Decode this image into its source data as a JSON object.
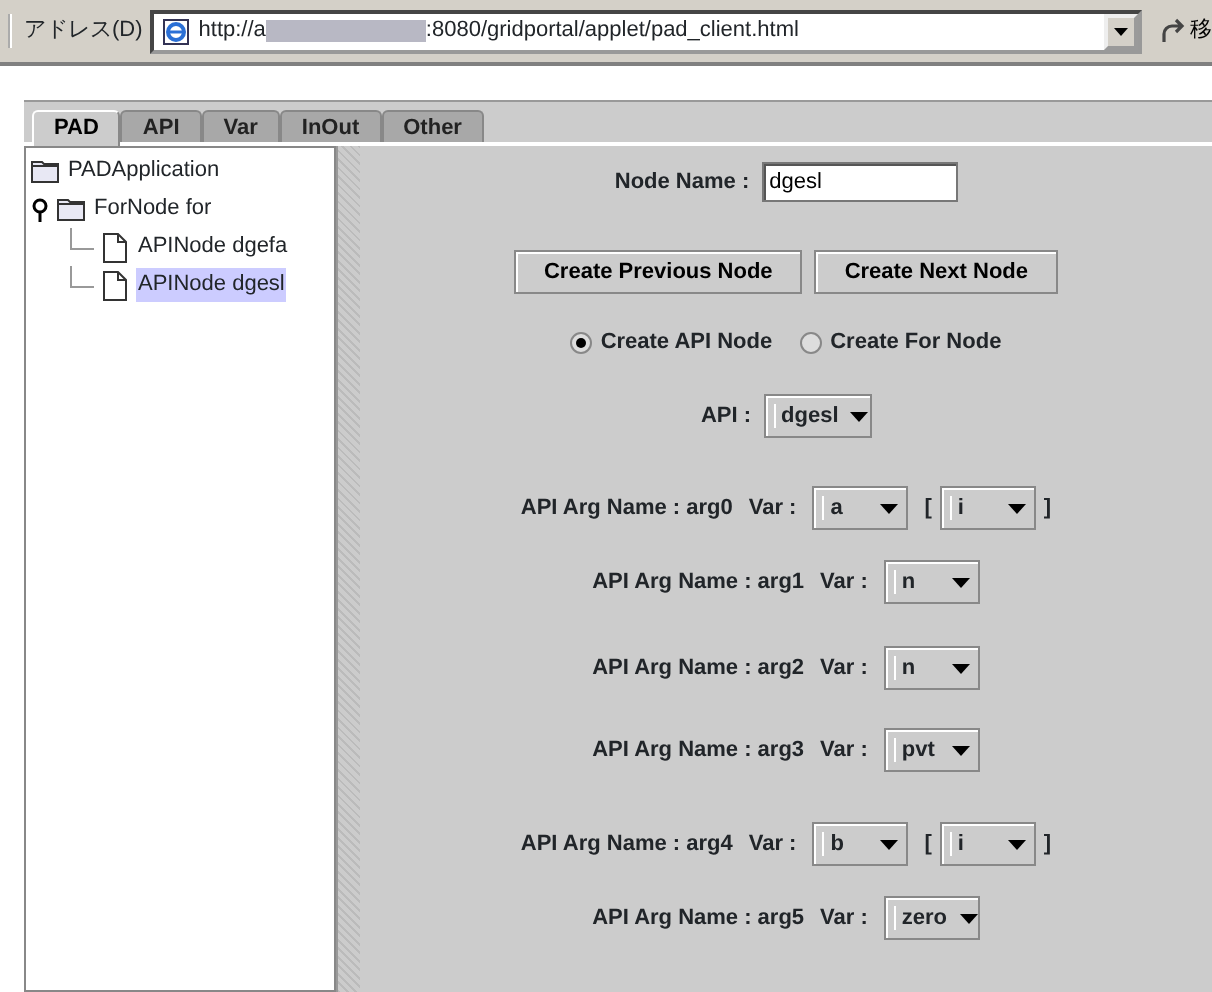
{
  "address_bar": {
    "label": "アドレス(D)",
    "url_start": "http://a",
    "url_end": ":8080/gridportal/applet/pad_client.html",
    "go_button": "移"
  },
  "tabs": [
    {
      "label": "PAD",
      "selected": true
    },
    {
      "label": "API",
      "selected": false
    },
    {
      "label": "Var",
      "selected": false
    },
    {
      "label": "InOut",
      "selected": false
    },
    {
      "label": "Other",
      "selected": false
    }
  ],
  "tree": [
    {
      "label": "PADApplication",
      "kind": "folder",
      "selected": false
    },
    {
      "label": "ForNode for",
      "kind": "folder",
      "selected": false,
      "expanded": true,
      "children": [
        {
          "label": "APINode dgefa",
          "kind": "file",
          "selected": false
        },
        {
          "label": "APINode dgesl",
          "kind": "file",
          "selected": true
        }
      ]
    }
  ],
  "node_name": {
    "label": "Node Name :",
    "value": "dgesl"
  },
  "buttons": [
    "Create Previous Node",
    "Create Next Node"
  ],
  "radios": [
    {
      "label": "Create API Node",
      "selected": true
    },
    {
      "label": "Create For Node",
      "selected": false
    }
  ],
  "api": {
    "label": "API :",
    "value": "dgesl"
  },
  "args": [
    {
      "name": "API Arg Name : arg0",
      "var_label": "Var :",
      "var": "a",
      "index": "i",
      "open": "[",
      "close": "]"
    },
    {
      "name": "API Arg Name : arg1",
      "var_label": "Var :",
      "var": "n"
    },
    {
      "name": "API Arg Name : arg2",
      "var_label": "Var :",
      "var": "n"
    },
    {
      "name": "API Arg Name : arg3",
      "var_label": "Var :",
      "var": "pvt"
    },
    {
      "name": "API Arg Name : arg4",
      "var_label": "Var :",
      "var": "b",
      "index": "i",
      "open": "[",
      "close": "]"
    },
    {
      "name": "API Arg Name : arg5",
      "var_label": "Var :",
      "var": "zero"
    }
  ]
}
